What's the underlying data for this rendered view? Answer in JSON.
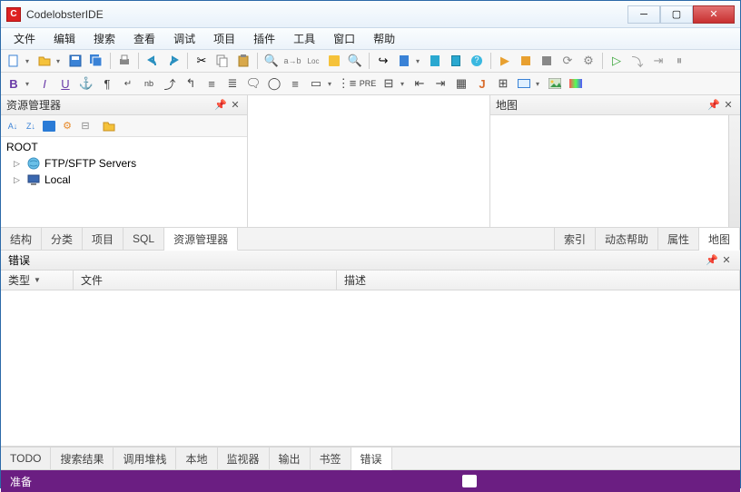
{
  "window": {
    "title": "CodelobsterIDE"
  },
  "menu": [
    "文件",
    "编辑",
    "搜索",
    "查看",
    "调试",
    "项目",
    "插件",
    "工具",
    "窗口",
    "帮助"
  ],
  "left_panel": {
    "title": "资源管理器",
    "root": "ROOT",
    "items": [
      {
        "label": "FTP/SFTP Servers",
        "icon": "globe"
      },
      {
        "label": "Local",
        "icon": "pc"
      }
    ],
    "tabs": [
      "结构",
      "分类",
      "项目",
      "SQL",
      "资源管理器"
    ],
    "active_tab": 4
  },
  "right_panel": {
    "title": "地图",
    "tabs": [
      "索引",
      "动态帮助",
      "属性",
      "地图"
    ],
    "active_tab": 3
  },
  "errors_panel": {
    "title": "错误",
    "columns": [
      "类型",
      "文件",
      "描述"
    ],
    "tabs": [
      "TODO",
      "搜索结果",
      "调用堆栈",
      "本地",
      "监视器",
      "输出",
      "书签",
      "错误"
    ],
    "active_tab": 7
  },
  "status": {
    "text": "准备"
  }
}
